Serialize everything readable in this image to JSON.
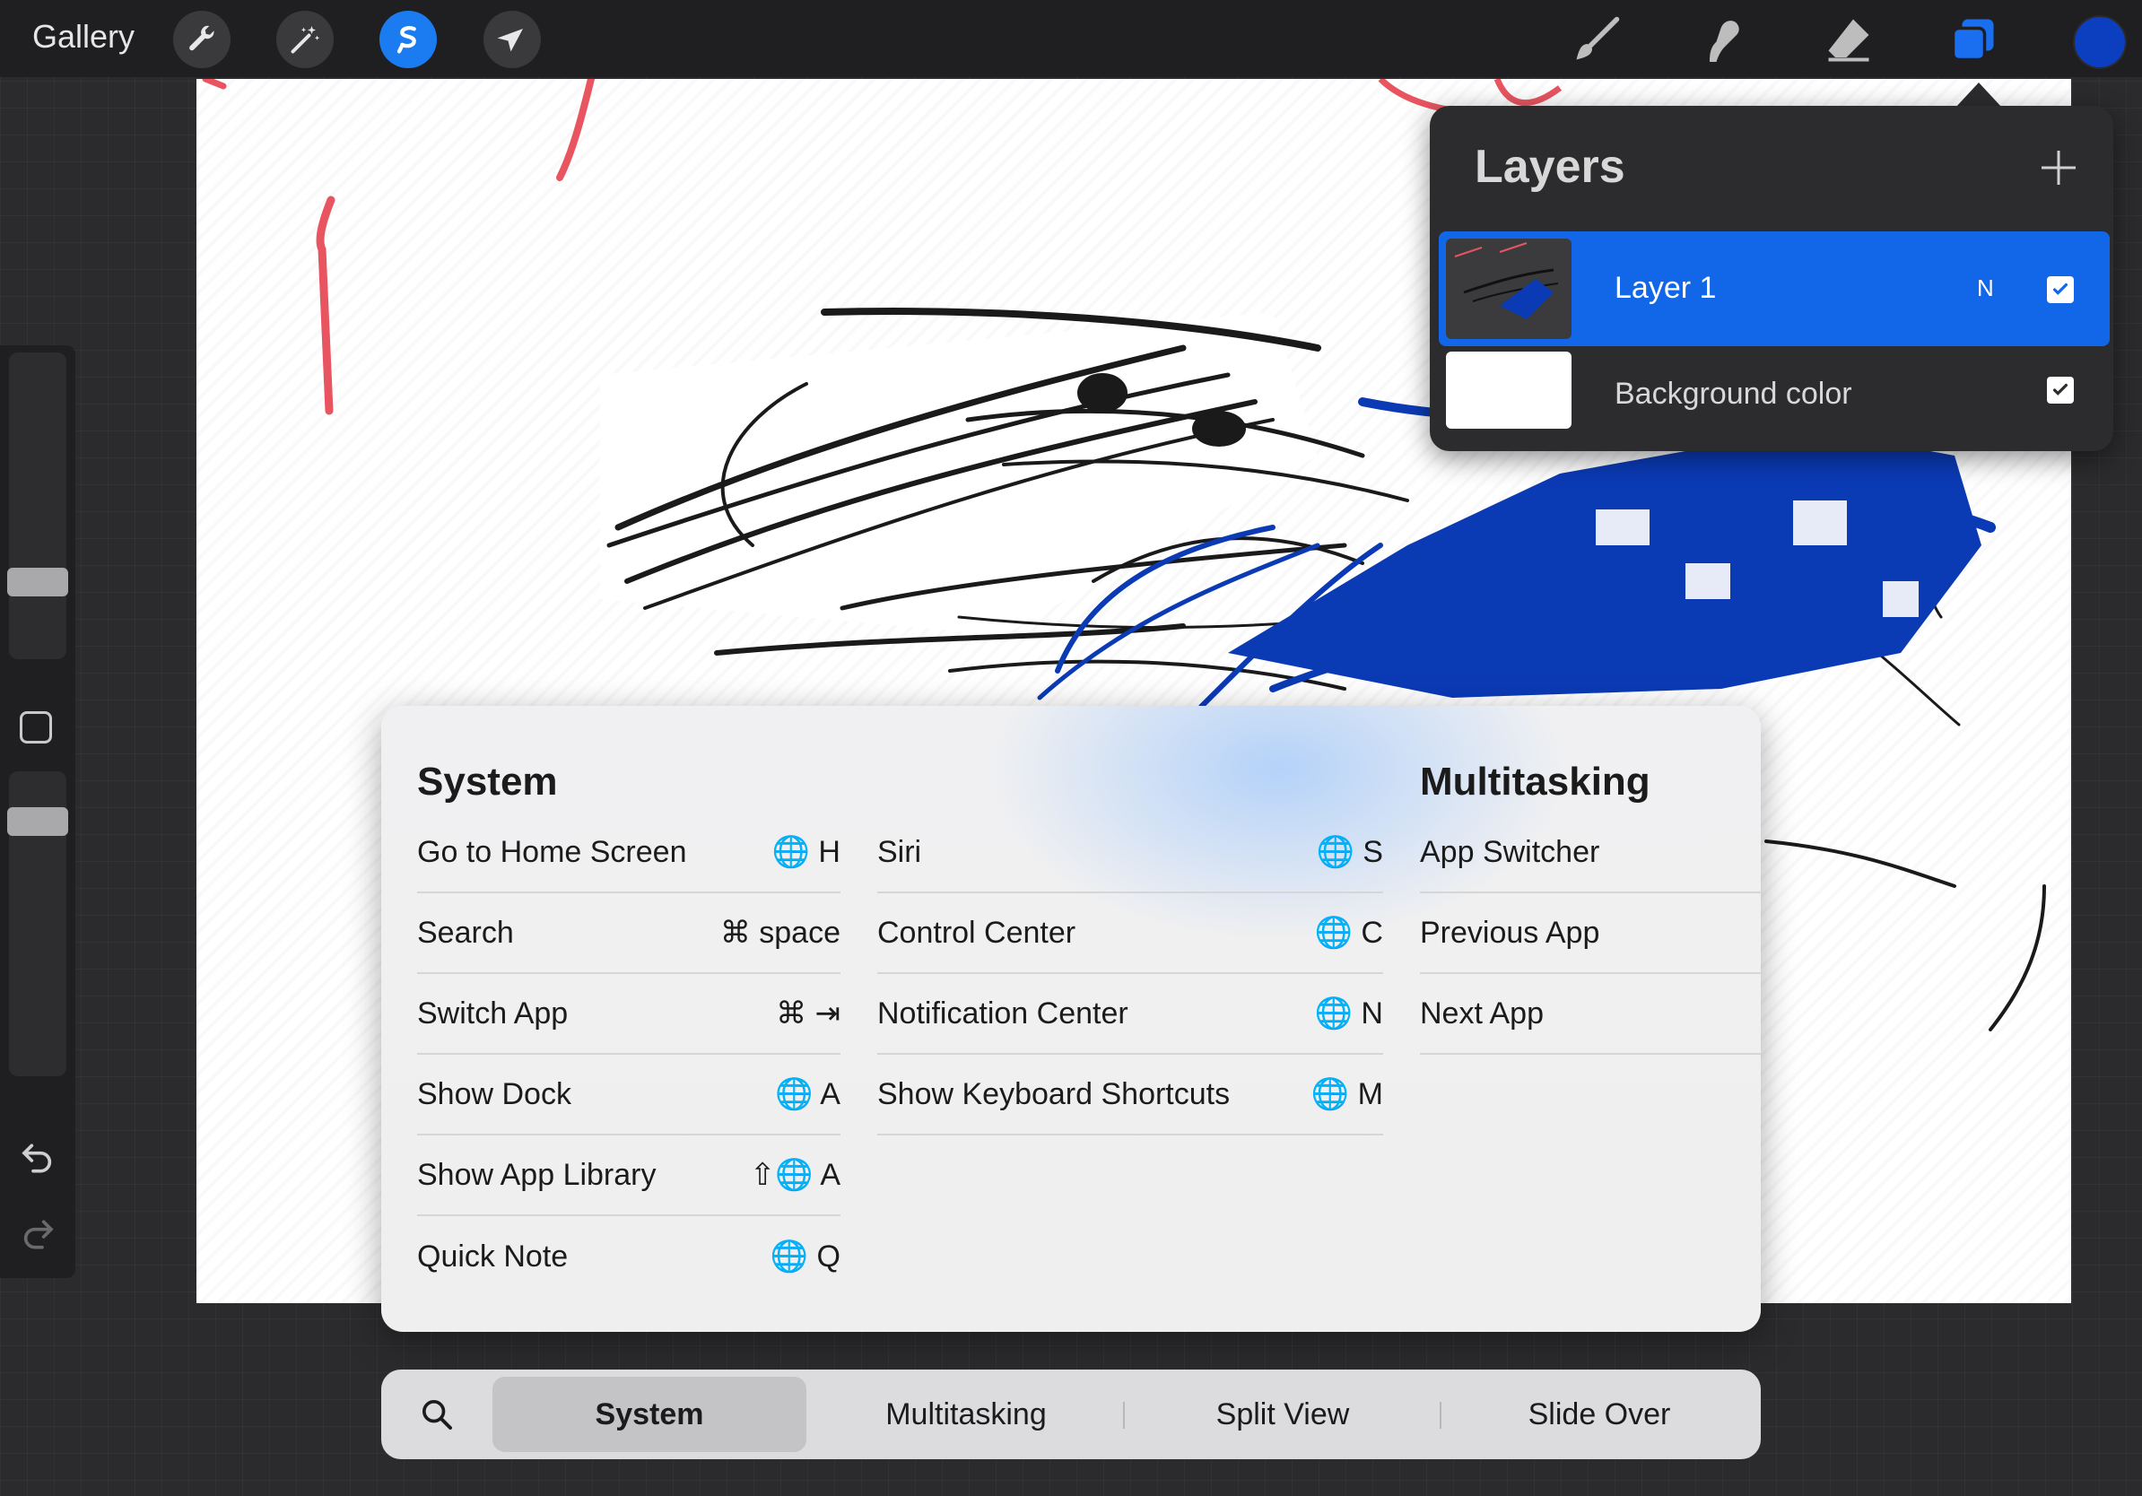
{
  "topbar": {
    "gallery_label": "Gallery",
    "left_tools": [
      {
        "icon": "wrench-icon",
        "name": "Actions"
      },
      {
        "icon": "magic-wand-icon",
        "name": "Adjustments"
      },
      {
        "icon": "selection-icon",
        "name": "Selection",
        "active": true
      },
      {
        "icon": "arrow-cursor-icon",
        "name": "Transform"
      }
    ],
    "right_tools": [
      "brush-icon",
      "smudge-icon",
      "eraser-icon",
      "layers-icon"
    ],
    "current_color": "#0c3fc0"
  },
  "layers_panel": {
    "title": "Layers",
    "layers": [
      {
        "name": "Layer 1",
        "mode": "N",
        "visible": true,
        "selected": true
      },
      {
        "name": "Background color",
        "mode": "",
        "visible": true,
        "selected": false
      }
    ]
  },
  "shortcuts": {
    "system_title": "System",
    "multitasking_title": "Multitasking",
    "col1": [
      {
        "label": "Go to Home Screen",
        "key": "🌐 H"
      },
      {
        "label": "Search",
        "key": "⌘ space"
      },
      {
        "label": "Switch App",
        "key": "⌘ ⇥"
      },
      {
        "label": "Show Dock",
        "key": "🌐 A"
      },
      {
        "label": "Show App Library",
        "key": "⇧🌐 A"
      },
      {
        "label": "Quick Note",
        "key": "🌐 Q"
      }
    ],
    "col2": [
      {
        "label": "Siri",
        "key": "🌐 S"
      },
      {
        "label": "Control Center",
        "key": "🌐 C"
      },
      {
        "label": "Notification Center",
        "key": "🌐 N"
      },
      {
        "label": "Show Keyboard Shortcuts",
        "key": "🌐 M"
      }
    ],
    "col3": [
      {
        "label": "App Switcher"
      },
      {
        "label": "Previous App"
      },
      {
        "label": "Next App"
      }
    ]
  },
  "tabbar": {
    "tabs": [
      "System",
      "Multitasking",
      "Split View",
      "Slide Over"
    ],
    "selected": "System"
  }
}
